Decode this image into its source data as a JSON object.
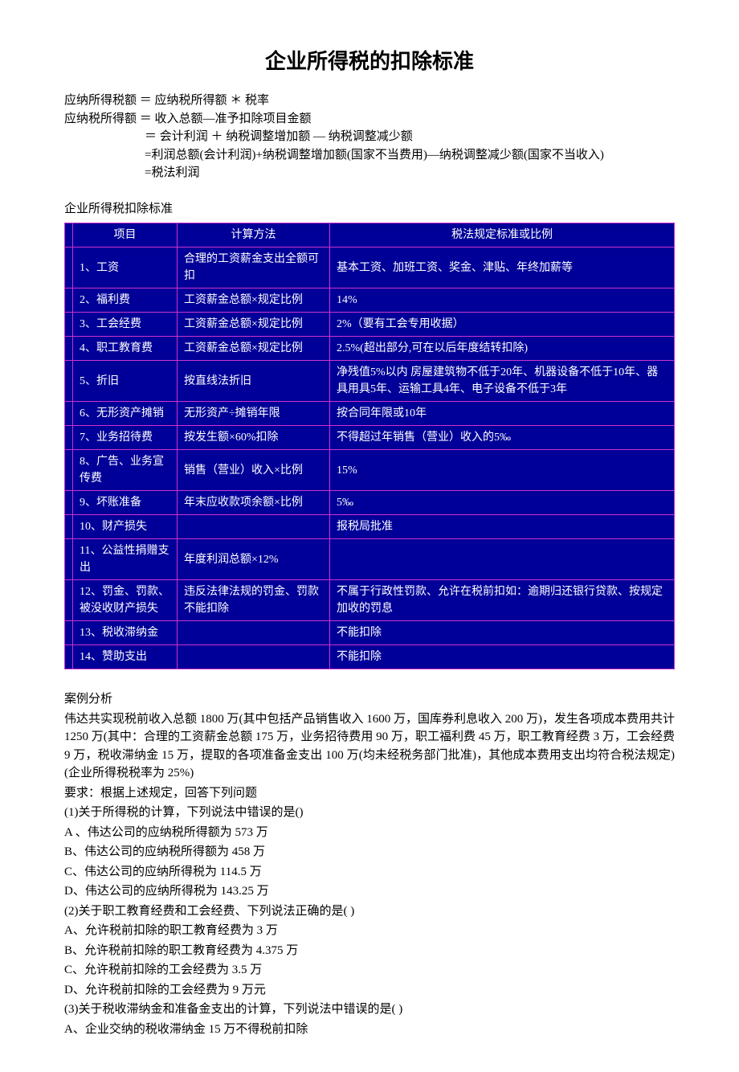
{
  "title": "企业所得税的扣除标准",
  "formulas": {
    "line1": "应纳所得税额 ＝ 应纳税所得额 ＊ 税率",
    "line2": "应纳税所得额 ＝ 收入总额—准予扣除项目金额",
    "line3": "＝ 会计利润 ＋ 纳税调整增加额 — 纳税调整减少额",
    "line4": "=利润总额(会计利润)+纳税调整增加额(国家不当费用)—纳税调整减少额(国家不当收入)",
    "line5": "=税法利润"
  },
  "table_caption": "企业所得税扣除标准",
  "headers": {
    "item": "项目",
    "method": "计算方法",
    "rule": "税法规定标准或比例"
  },
  "rows": [
    {
      "item": "1、工资",
      "method": "合理的工资薪金支出全额可扣",
      "rule": "基本工资、加班工资、奖金、津贴、年终加薪等"
    },
    {
      "item": "2、福利费",
      "method": "工资薪金总额×规定比例",
      "rule": "14%"
    },
    {
      "item": "3、工会经费",
      "method": "工资薪金总额×规定比例",
      "rule": "2%（要有工会专用收据）"
    },
    {
      "item": "4、职工教育费",
      "method": "工资薪金总额×规定比例",
      "rule": "2.5%(超出部分,可在以后年度结转扣除)"
    },
    {
      "item": "5、折旧",
      "method": "按直线法折旧",
      "rule": "净残值5%以内 房屋建筑物不低于20年、机器设备不低于10年、器具用具5年、运输工具4年、电子设备不低于3年"
    },
    {
      "item": "6、无形资产摊销",
      "method": "无形资产÷摊销年限",
      "rule": "按合同年限或10年"
    },
    {
      "item": "7、业务招待费",
      "method": "按发生额×60%扣除",
      "rule": "不得超过年销售（营业）收入的5‰"
    },
    {
      "item": "8、广告、业务宣传费",
      "method": "销售（营业）收入×比例",
      "rule": "15%"
    },
    {
      "item": "9、坏账准备",
      "method": "年末应收款项余额×比例",
      "rule": "5‰"
    },
    {
      "item": "10、财产损失",
      "method": "",
      "rule": "报税局批准"
    },
    {
      "item": "11、公益性捐赠支出",
      "method": "年度利润总额×12%",
      "rule": ""
    },
    {
      "item": "12、罚金、罚款、被没收财产损失",
      "method": "违反法律法规的罚金、罚款不能扣除",
      "rule": "不属于行政性罚款、允许在税前扣如：逾期归还银行贷款、按规定加收的罚息"
    },
    {
      "item": "13、税收滞纳金",
      "method": "",
      "rule": "不能扣除"
    },
    {
      "item": "14、赞助支出",
      "method": "",
      "rule": "不能扣除"
    }
  ],
  "case": {
    "heading": "案例分析",
    "intro": "伟达共实现税前收入总额 1800 万(其中包括产品销售收入 1600 万，国库券利息收入 200 万)，发生各项成本费用共计 1250 万(其中：合理的工资薪金总额 175 万，业务招待费用 90 万，职工福利费 45 万，职工教育经费 3 万，工会经费 9 万，税收滞纳金 15 万，提取的各项准备金支出 100 万(均未经税务部门批准)，其他成本费用支出均符合税法规定)(企业所得税税率为 25%)",
    "req": "要求：根据上述规定，回答下列问题",
    "q1": "(1)关于所得税的计算，下列说法中错误的是()",
    "q1a": "A 、伟达公司的应纳税所得额为 573 万",
    "q1b": "B、伟达公司的应纳税所得额为 458 万",
    "q1c": "C、伟达公司的应纳所得税为 114.5 万",
    "q1d": "D、伟达公司的应纳所得税为 143.25 万",
    "q2": "(2)关于职工教育经费和工会经费、下列说法正确的是(    )",
    "q2a": "A、允许税前扣除的职工教育经费为 3 万",
    "q2b": "B、允许税前扣除的职工教育经费为 4.375 万",
    "q2c": "C、允许税前扣除的工会经费为 3.5 万",
    "q2d": "D、允许税前扣除的工会经费为 9 万元",
    "q3": "(3)关于税收滞纳金和准备金支出的计算，下列说法中错误的是(    )",
    "q3a": "A、企业交纳的税收滞纳金 15 万不得税前扣除"
  }
}
